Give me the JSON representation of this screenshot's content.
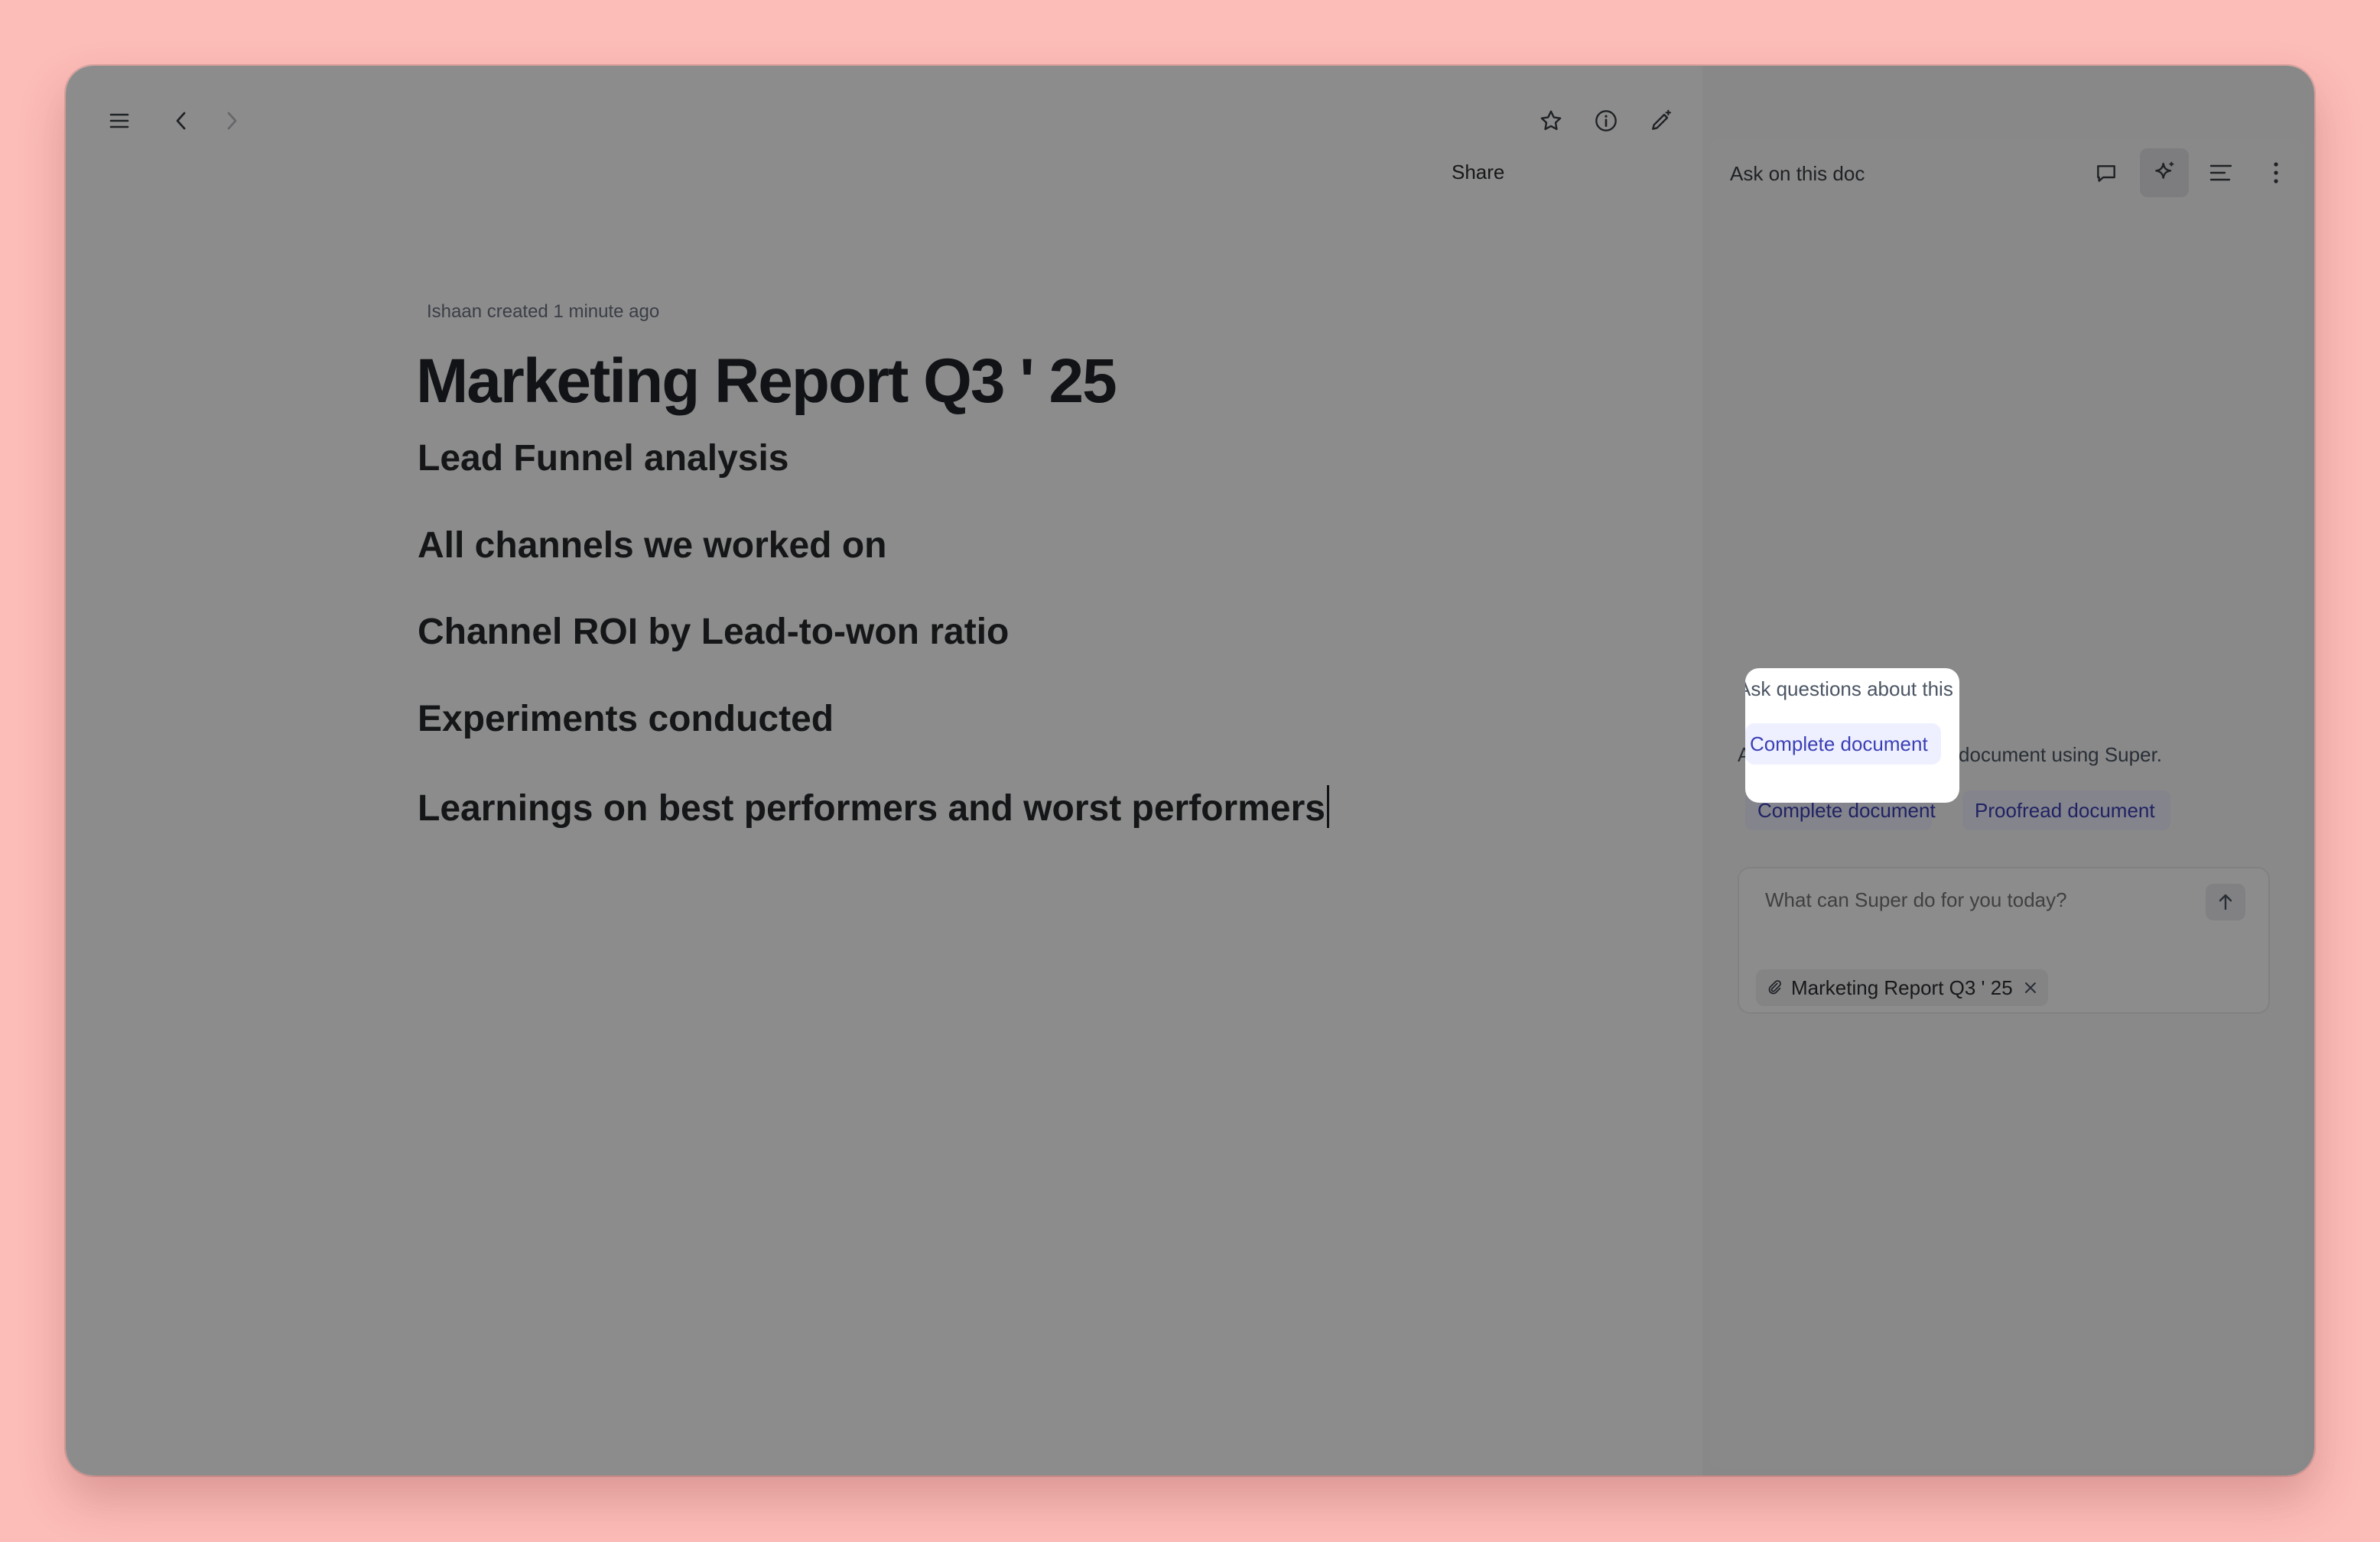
{
  "toolbar": {
    "share_label": "Share",
    "panel_title": "Ask on this doc"
  },
  "icons": {
    "menu": "menu-icon",
    "back": "chevron-left-icon",
    "forward": "chevron-right-icon",
    "star": "star-icon",
    "info": "info-icon",
    "edit": "edit-sparkle-icon",
    "comments": "comment-icon",
    "ai": "sparkle-icon",
    "outline": "outline-icon",
    "more": "more-vertical-icon",
    "send": "arrow-up-icon",
    "attach": "paperclip-icon",
    "remove": "close-icon"
  },
  "document": {
    "meta": "Ishaan created 1 minute ago",
    "title": "Marketing Report Q3 ' 25",
    "headings": [
      "Lead Funnel analysis",
      "All channels we worked on",
      "Channel ROI by Lead-to-won ratio",
      "Experiments conducted",
      "Learnings on best performers and worst performers"
    ]
  },
  "assistant": {
    "hint": "Ask questions about this document using Super.",
    "actions": [
      "Complete document",
      "Proofread document"
    ],
    "input_placeholder": "What can Super do for you today?",
    "attachment": "Marketing Report Q3 ' 25"
  },
  "colors": {
    "background": "#fcbcb8",
    "accent": "#3b3fb5",
    "chip_bg": "#eef0ff"
  }
}
